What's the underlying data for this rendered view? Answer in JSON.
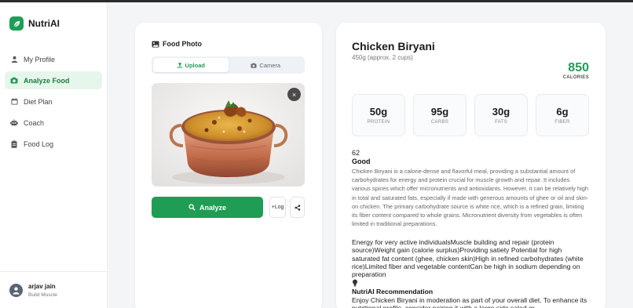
{
  "app": {
    "name": "NutriAI"
  },
  "sidebar": {
    "items": [
      {
        "label": "My Profile",
        "icon": "user-icon",
        "active": false
      },
      {
        "label": "Analyze Food",
        "icon": "camera-icon",
        "active": true
      },
      {
        "label": "Diet Plan",
        "icon": "calendar-icon",
        "active": false
      },
      {
        "label": "Coach",
        "icon": "robot-icon",
        "active": false
      },
      {
        "label": "Food Log",
        "icon": "clipboard-icon",
        "active": false
      }
    ],
    "profile": {
      "name": "arjav jain",
      "goal": "Build Muscle"
    }
  },
  "photo_panel": {
    "title": "Food Photo",
    "tabs": {
      "upload": "Upload",
      "camera": "Camera"
    },
    "close_symbol": "×",
    "analyze_label": "Analyze",
    "log_label": "+Log"
  },
  "result": {
    "food_name": "Chicken Biryani",
    "serving": "450g (approx. 2 cups)",
    "calories": "850",
    "calories_label": "CALORIES",
    "macros": {
      "protein": {
        "value": "50g",
        "label": "PROTEIN"
      },
      "carbs": {
        "value": "95g",
        "label": "CARBS"
      },
      "fats": {
        "value": "30g",
        "label": "FATS"
      },
      "fiber": {
        "value": "6g",
        "label": "FIBER"
      }
    },
    "score": "62",
    "rating": "Good",
    "description": "Chicken Biryani is a calorie-dense and flavorful meal, providing a substantial amount of carbohydrates for energy and protein crucial for muscle growth and repair. It includes various spices which offer micronutrients and antioxidants. However, it can be relatively high in total and saturated fats, especially if made with generous amounts of ghee or oil and skin-on chicken. The primary carbohydrate source is white rice, which is a refined grain, limiting its fiber content compared to whole grains. Micronutrient diversity from vegetables is often limited in traditional preparations.",
    "details": "Energy for very active individualsMuscle building and repair (protein source)Weight gain (calorie surplus)Providing satiety Potential for high saturated fat content (ghee, chicken skin)High in refined carbohydrates (white rice)Limited fiber and vegetable contentCan be high in sodium depending on preparation",
    "recommendation_title": "NutriAI Recommendation",
    "recommendation": "Enjoy Chicken Biryani in moderation as part of your overall diet. To enhance its nutritional profile, consider pairing it with a large side salad or"
  },
  "colors": {
    "accent": "#1f9d55",
    "accent_light": "#e7f6ec"
  }
}
